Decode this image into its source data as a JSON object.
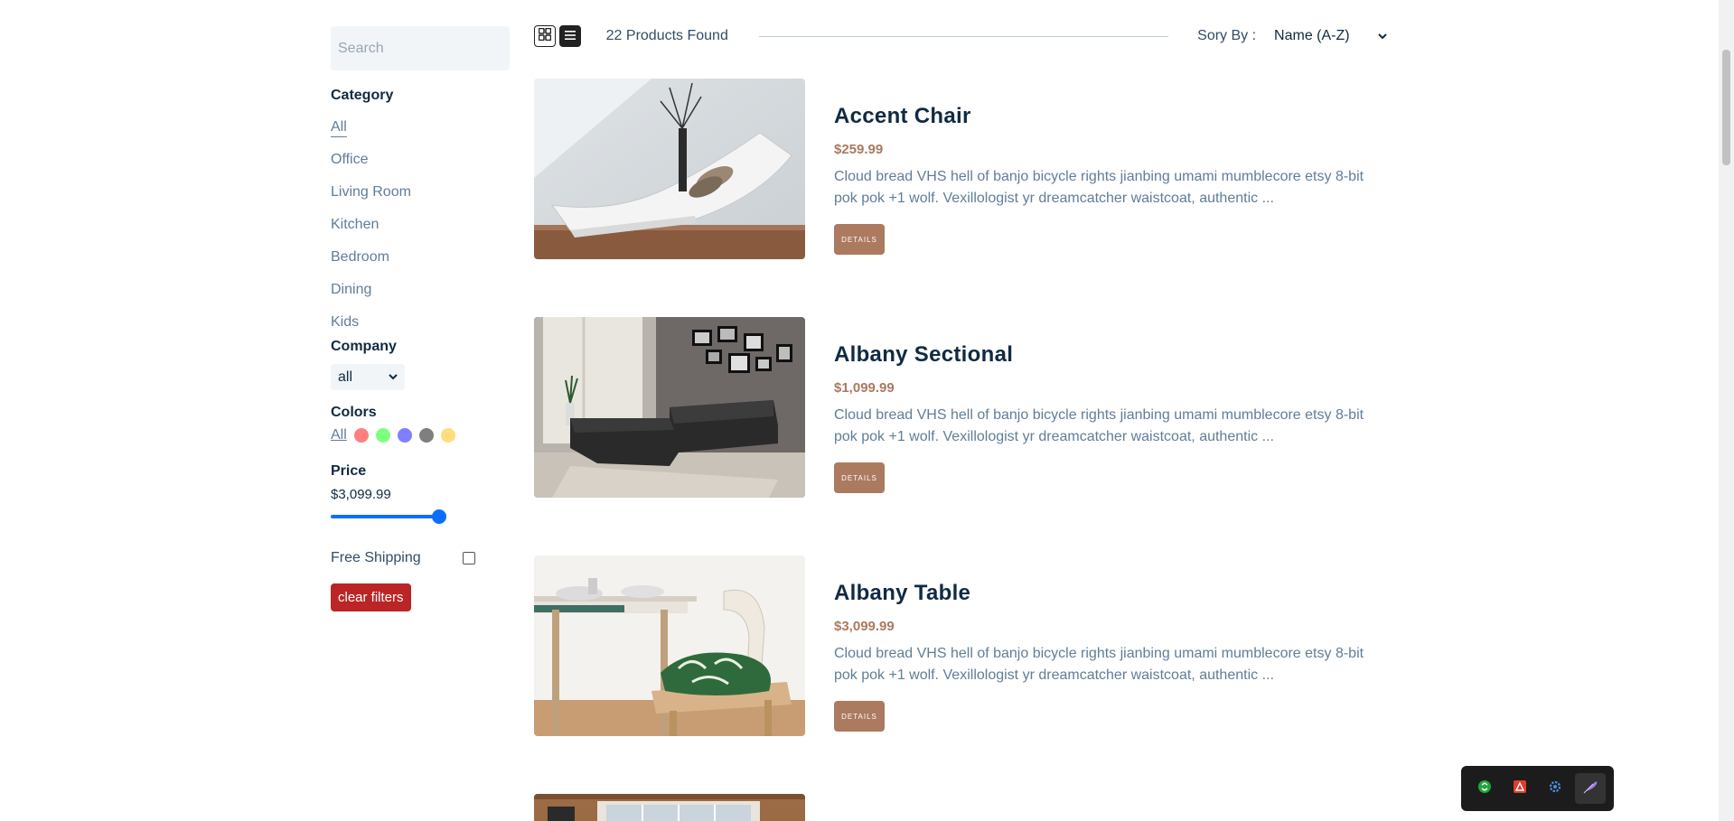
{
  "sidebar": {
    "search_placeholder": "Search",
    "category_heading": "Category",
    "categories": [
      "All",
      "Office",
      "Living Room",
      "Kitchen",
      "Bedroom",
      "Dining",
      "Kids"
    ],
    "company_heading": "Company",
    "company_selected": "all",
    "colors_heading": "Colors",
    "colors_all_label": "All",
    "colors": [
      "#ff0000",
      "#00ff00",
      "#0000ff",
      "#000000",
      "#ffb900"
    ],
    "price_heading": "Price",
    "price_value": "$3,099.99",
    "price_fraction": 1.0,
    "free_shipping_label": "Free Shipping",
    "clear_label": "clear filters"
  },
  "topbar": {
    "count_text": "22 Products Found",
    "sort_label": "Sory By :",
    "sort_selected": "Name (A-Z)"
  },
  "products": [
    {
      "name": "Accent Chair",
      "price": "$259.99",
      "desc": "Cloud bread VHS hell of banjo bicycle rights jianbing umami mumblecore etsy 8-bit pok pok +1 wolf. Vexillologist yr dreamcatcher waistcoat, authentic ...",
      "button": "DETAILS"
    },
    {
      "name": "Albany Sectional",
      "price": "$1,099.99",
      "desc": "Cloud bread VHS hell of banjo bicycle rights jianbing umami mumblecore etsy 8-bit pok pok +1 wolf. Vexillologist yr dreamcatcher waistcoat, authentic ...",
      "button": "DETAILS"
    },
    {
      "name": "Albany Table",
      "price": "$3,099.99",
      "desc": "Cloud bread VHS hell of banjo bicycle rights jianbing umami mumblecore etsy 8-bit pok pok +1 wolf. Vexillologist yr dreamcatcher waistcoat, authentic ...",
      "button": "DETAILS"
    }
  ],
  "icons": {
    "grid_view": "grid-icon",
    "list_view": "list-icon",
    "sort_chevron": "chevron-down-icon",
    "company_chevron": "chevron-down-icon"
  }
}
